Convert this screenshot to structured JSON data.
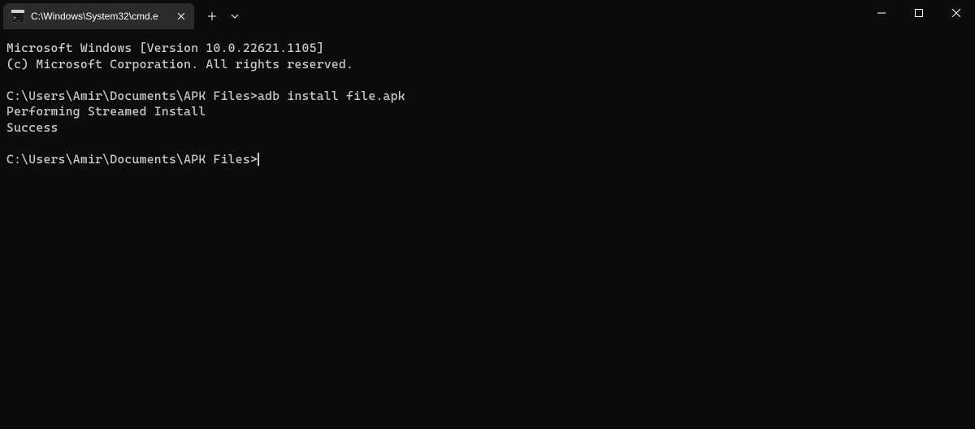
{
  "tab": {
    "title": "C:\\Windows\\System32\\cmd.e"
  },
  "terminal": {
    "lines": [
      "Microsoft Windows [Version 10.0.22621.1105]",
      "(c) Microsoft Corporation. All rights reserved.",
      "",
      "C:\\Users\\Amir\\Documents\\APK Files>adb install file.apk",
      "Performing Streamed Install",
      "Success",
      "",
      "C:\\Users\\Amir\\Documents\\APK Files>"
    ]
  }
}
